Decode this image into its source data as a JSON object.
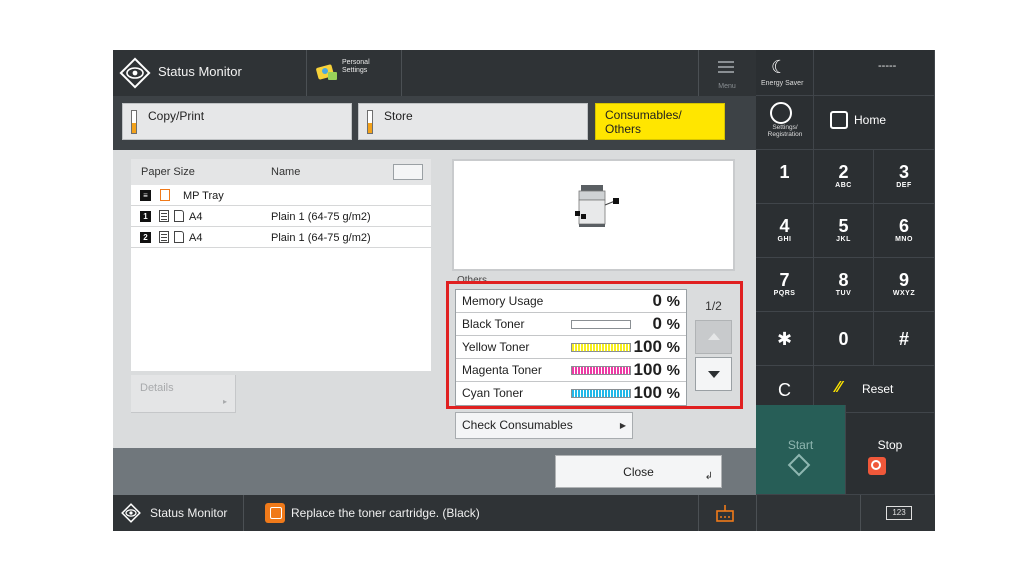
{
  "topbar": {
    "title": "Status Monitor",
    "personal_settings": "Personal Settings",
    "menu": "Menu"
  },
  "tabs": [
    {
      "label": "Copy/Print",
      "active": false
    },
    {
      "label": "Store",
      "active": false
    },
    {
      "label": "Consumables/ Others",
      "active": true
    }
  ],
  "paper_table": {
    "headers": {
      "size": "Paper Size",
      "name": "Name"
    },
    "rows": [
      {
        "source": "MP Tray",
        "size": "",
        "name": ""
      },
      {
        "source": "1",
        "size": "A4",
        "name": "Plain 1 (64-75 g/m2)"
      },
      {
        "source": "2",
        "size": "A4",
        "name": "Plain 1 (64-75 g/m2)"
      }
    ]
  },
  "details_button": "Details",
  "others_label": "Others",
  "status_items": [
    {
      "name": "Memory Usage",
      "percent": "0",
      "unit": "%",
      "bar_level": null,
      "bar_color": null
    },
    {
      "name": "Black Toner",
      "percent": "0",
      "unit": "%",
      "bar_level": 0,
      "bar_color": "#e6e6f0"
    },
    {
      "name": "Yellow Toner",
      "percent": "100",
      "unit": "%",
      "bar_level": 1,
      "bar_color": "#f7ef1e"
    },
    {
      "name": "Magenta Toner",
      "percent": "100",
      "unit": "%",
      "bar_level": 1,
      "bar_color": "#ee3aa5"
    },
    {
      "name": "Cyan Toner",
      "percent": "100",
      "unit": "%",
      "bar_level": 1,
      "bar_color": "#22b8e8"
    }
  ],
  "pager": {
    "label": "1/2"
  },
  "check_consumables_button": "Check Consumables",
  "close_button": "Close",
  "statusbar": {
    "title": "Status Monitor",
    "message": "Replace the toner cartridge. (Black)",
    "keypad_toggle": "123"
  },
  "keypad": {
    "energy_saver": "Energy Saver",
    "login_status": "-----",
    "settings": "Settings/ Registration",
    "home": "Home",
    "keys": [
      {
        "digit": "1",
        "letters": ""
      },
      {
        "digit": "2",
        "letters": "ABC"
      },
      {
        "digit": "3",
        "letters": "DEF"
      },
      {
        "digit": "4",
        "letters": "GHI"
      },
      {
        "digit": "5",
        "letters": "JKL"
      },
      {
        "digit": "6",
        "letters": "MNO"
      },
      {
        "digit": "7",
        "letters": "PQRS"
      },
      {
        "digit": "8",
        "letters": "TUV"
      },
      {
        "digit": "9",
        "letters": "WXYZ"
      },
      {
        "digit": "✱",
        "letters": ""
      },
      {
        "digit": "0",
        "letters": ""
      },
      {
        "digit": "#",
        "letters": ""
      }
    ],
    "clear": "C",
    "reset": "Reset",
    "start": "Start",
    "stop": "Stop"
  },
  "colors": {
    "highlight_frame": "#e02020",
    "active_tab": "#ffe600",
    "toner_indicator": "#f3a21a",
    "start": "#275e57",
    "stop_icon": "#f0583a"
  }
}
